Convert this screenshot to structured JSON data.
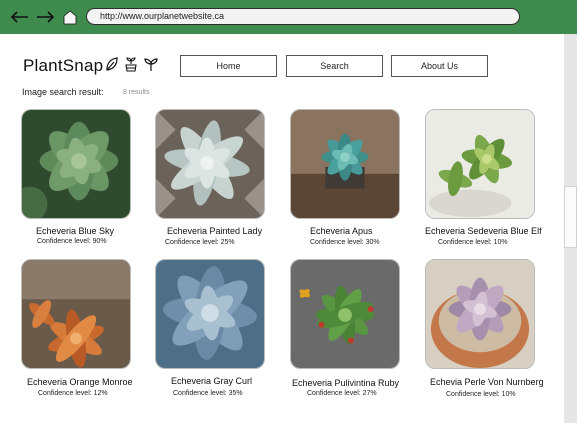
{
  "browser": {
    "url": "http://www.ourplanetwebsite.ca"
  },
  "header": {
    "logo": "PlantSnap",
    "nav": [
      "Home",
      "Search",
      "About Us"
    ]
  },
  "results": {
    "label": "Image search result:",
    "count": "8 results",
    "items": [
      {
        "name": "Echeveria Blue Sky",
        "confidence": "Confidence level: 90%"
      },
      {
        "name": "Echeveria Painted Lady",
        "confidence": "Confidence level: 25%"
      },
      {
        "name": "Echeveria Apus",
        "confidence": "Confidence level: 30%"
      },
      {
        "name": "Echeveria Sedeveria Blue Elf",
        "confidence": "Confidence level: 10%"
      },
      {
        "name": "Echeveria Orange Monroe",
        "confidence": "Confidence level: 12%"
      },
      {
        "name": "Echeveria Gray Curl",
        "confidence": "Confidence level: 35%"
      },
      {
        "name": "Echeveria Pulivintina Ruby",
        "confidence": "Confidence level: 27%"
      },
      {
        "name": "Echevia Perle Von Nurnberg",
        "confidence": "Confidence level: 10%"
      }
    ]
  },
  "colors": {
    "chrome": "#3f8b4e"
  }
}
